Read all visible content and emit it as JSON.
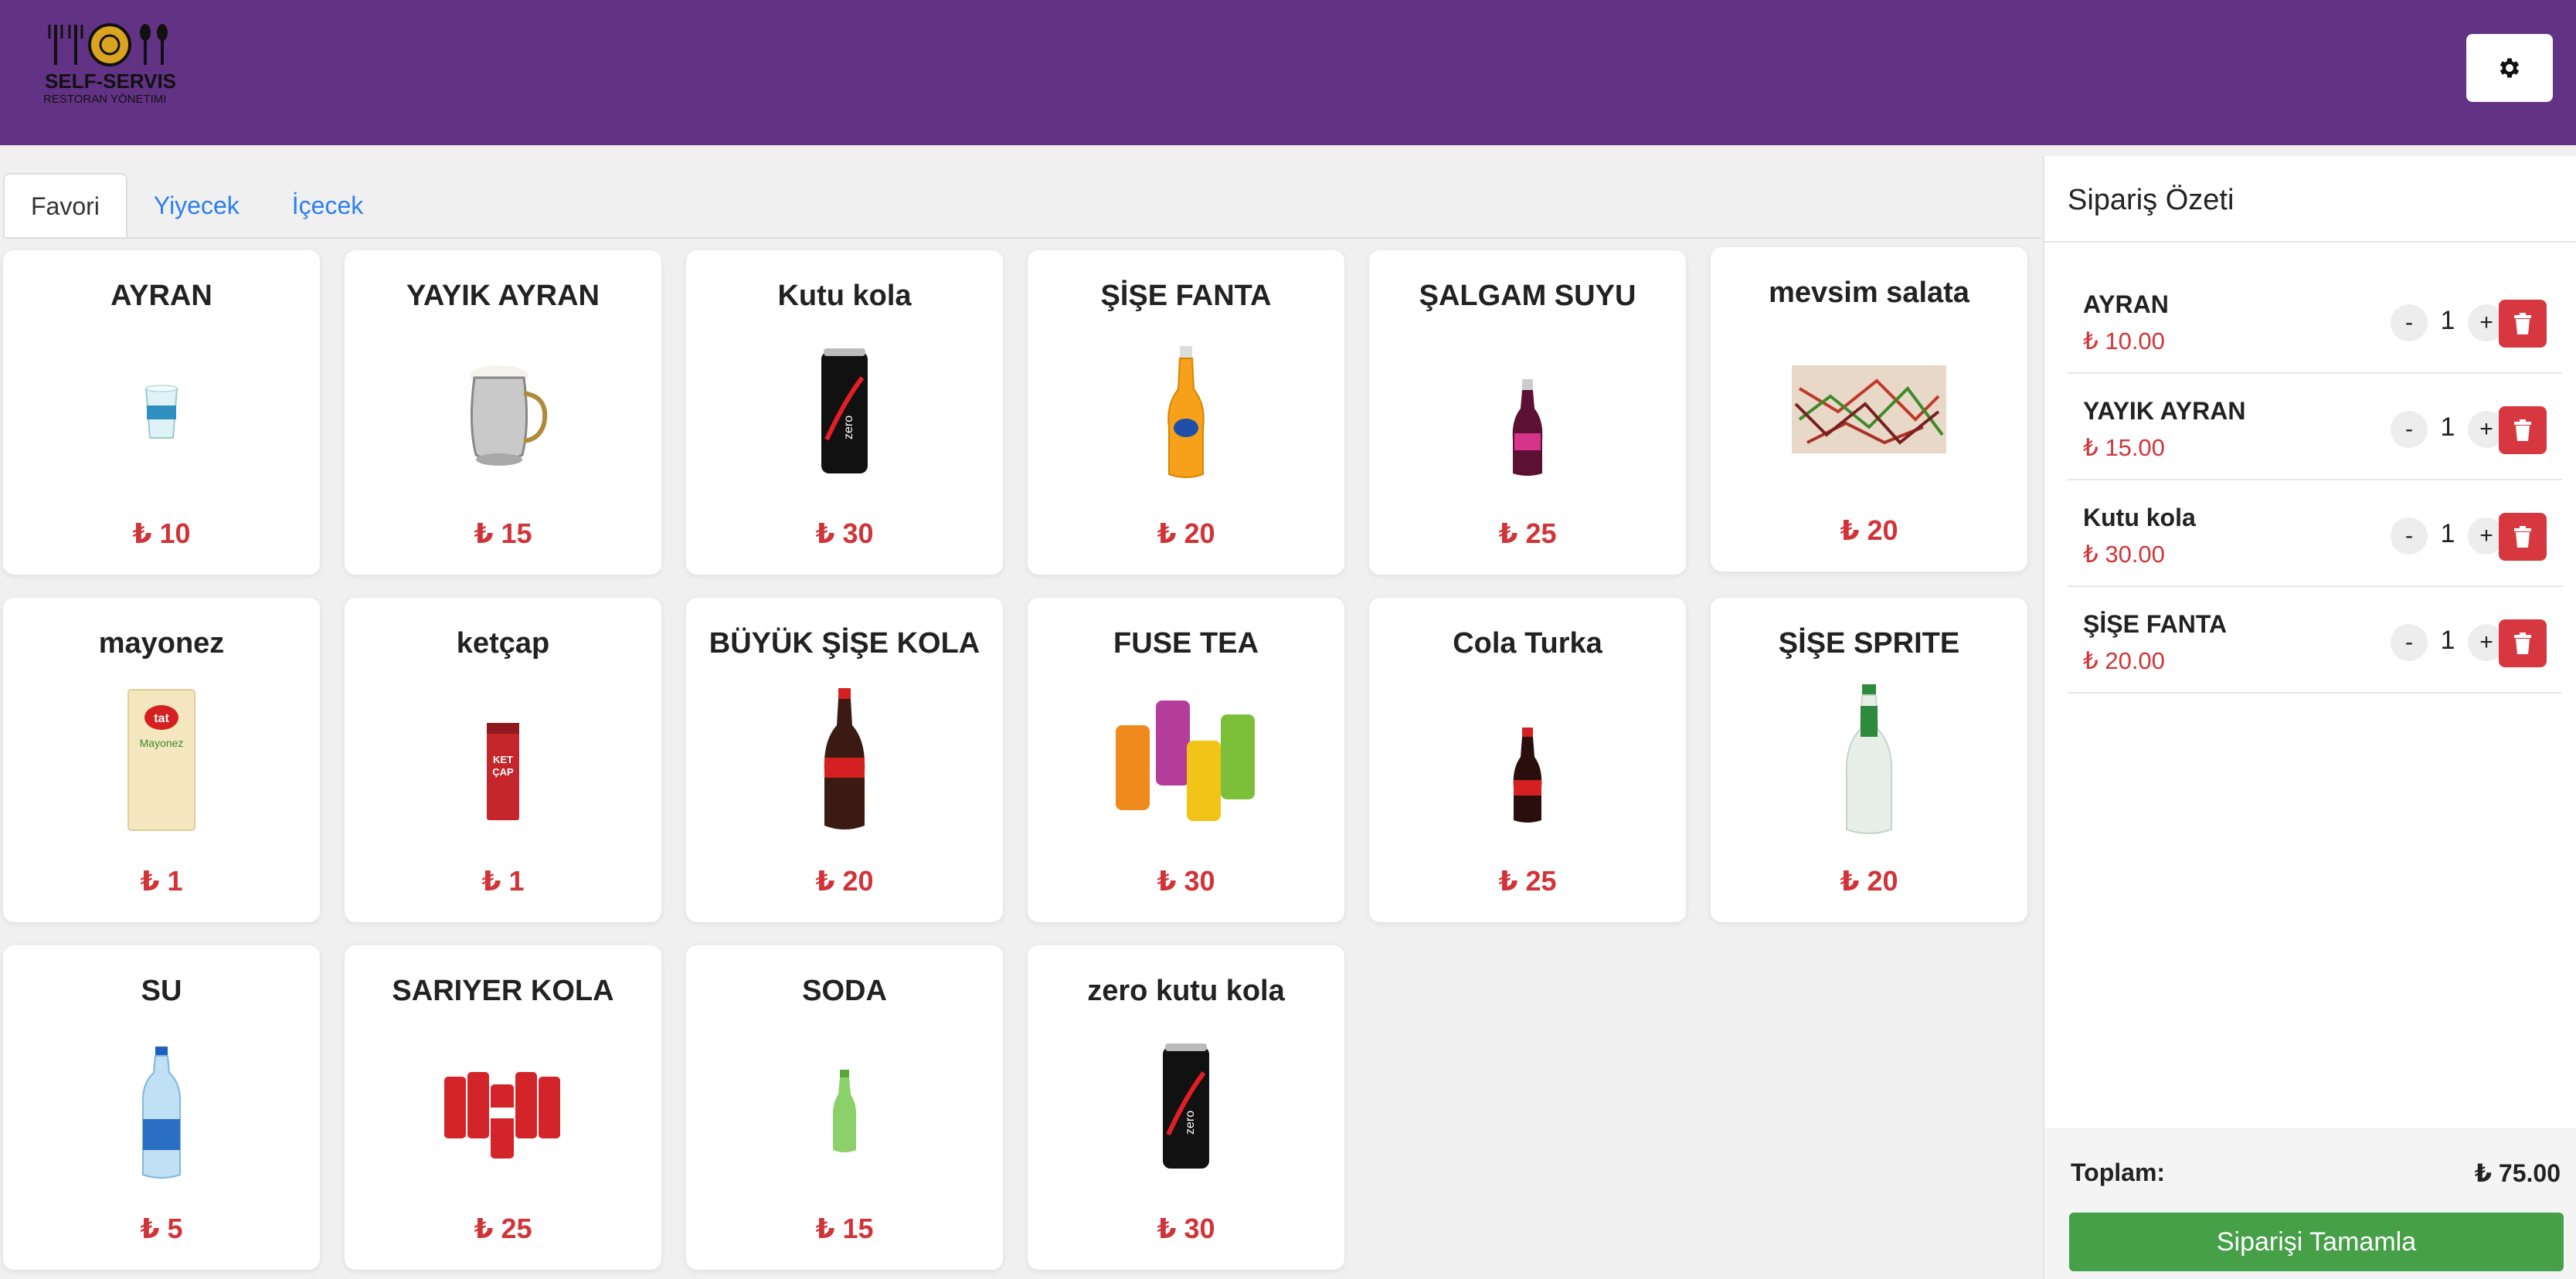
{
  "header": {
    "logo_line1": "SELF-SERVIS",
    "logo_line2": "RESTORAN YÖNETIMI",
    "settings_icon": "gear-icon",
    "color": "#623284"
  },
  "tabs": [
    {
      "label": "Favori",
      "active": true
    },
    {
      "label": "Yiyecek",
      "active": false
    },
    {
      "label": "İçecek",
      "active": false
    }
  ],
  "products": [
    {
      "name": "AYRAN",
      "price": "₺ 10",
      "image": "ayran-cup"
    },
    {
      "name": "YAYIK AYRAN",
      "price": "₺ 15",
      "image": "copper-jug"
    },
    {
      "name": "Kutu kola",
      "price": "₺ 30",
      "image": "cola-zero-can"
    },
    {
      "name": "ŞİŞE FANTA",
      "price": "₺ 20",
      "image": "fanta-bottle"
    },
    {
      "name": "ŞALGAM SUYU",
      "price": "₺ 25",
      "image": "salgam-bottle"
    },
    {
      "name": "mevsim salata",
      "price": "₺ 20",
      "image": "salad"
    },
    {
      "name": "mayonez",
      "price": "₺ 1",
      "image": "mayonnaise-sachet"
    },
    {
      "name": "ketçap",
      "price": "₺ 1",
      "image": "ketchup-sachet"
    },
    {
      "name": "BÜYÜK ŞİŞE KOLA",
      "price": "₺ 20",
      "image": "big-cola-bottle"
    },
    {
      "name": "FUSE TEA",
      "price": "₺ 30",
      "image": "fuse-tea-cans"
    },
    {
      "name": "Cola Turka",
      "price": "₺ 25",
      "image": "cola-turka-bottle"
    },
    {
      "name": "ŞİŞE SPRITE",
      "price": "₺ 20",
      "image": "sprite-bottle"
    },
    {
      "name": "SU",
      "price": "₺ 5",
      "image": "water-bottle"
    },
    {
      "name": "SARIYER KOLA",
      "price": "₺ 25",
      "image": "sariyer-cans"
    },
    {
      "name": "SODA",
      "price": "₺ 15",
      "image": "soda-bottle"
    },
    {
      "name": "zero kutu kola",
      "price": "₺ 30",
      "image": "cola-zero-can"
    }
  ],
  "order": {
    "title": "Sipariş Özeti",
    "items": [
      {
        "name": "AYRAN",
        "price": "₺ 10.00",
        "qty": "1"
      },
      {
        "name": "YAYIK AYRAN",
        "price": "₺ 15.00",
        "qty": "1"
      },
      {
        "name": "Kutu kola",
        "price": "₺ 30.00",
        "qty": "1"
      },
      {
        "name": "ŞİŞE FANTA",
        "price": "₺ 20.00",
        "qty": "1"
      }
    ],
    "minus": "-",
    "plus": "+",
    "total_label": "Toplam:",
    "total_value": "₺ 75.00",
    "complete_label": "Siparişi Tamamla"
  },
  "colors": {
    "price": "#d13438",
    "complete_button": "#46a048",
    "delete_button": "#d7383f",
    "tab_link": "#2d7ef0"
  }
}
